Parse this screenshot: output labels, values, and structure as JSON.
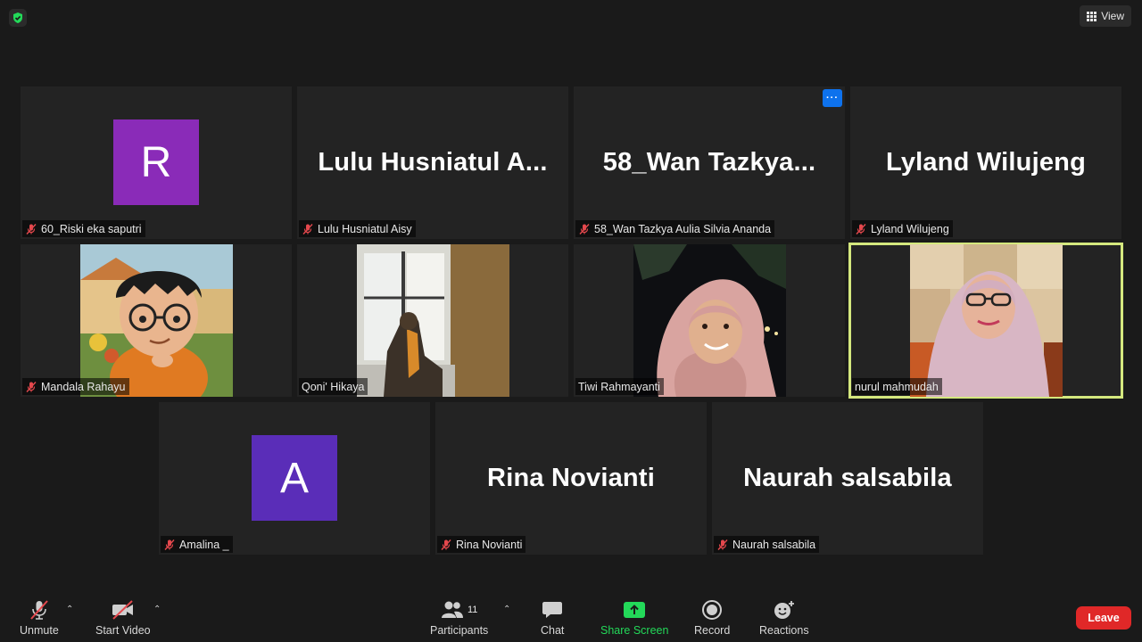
{
  "topbar": {
    "view_label": "View"
  },
  "tiles": [
    {
      "label": "60_Riski eka saputri",
      "avatar_letter": "R",
      "avatar_color": "#8a2bb8"
    },
    {
      "label": "Lulu Husniatul Aisy",
      "big_name": "Lulu  Husniatul  A..."
    },
    {
      "label": "58_Wan Tazkya Aulia Silvia Ananda",
      "big_name": "58_Wan  Tazkya..."
    },
    {
      "label": "Lyland Wilujeng",
      "big_name": "Lyland Wilujeng"
    },
    {
      "label": "Mandala Rahayu"
    },
    {
      "label": "Qoni' Hikaya"
    },
    {
      "label": "Tiwi Rahmayanti"
    },
    {
      "label": "nurul mahmudah"
    },
    {
      "label": "Amalina _",
      "avatar_letter": "A",
      "avatar_color": "#5a2db8"
    },
    {
      "label": "Rina Novianti",
      "big_name": "Rina Novianti"
    },
    {
      "label": "Naurah salsabila",
      "big_name": "Naurah salsabila"
    }
  ],
  "more_button": "···",
  "toolbar": {
    "unmute": "Unmute",
    "start_video": "Start Video",
    "participants": "Participants",
    "participants_count": "11",
    "chat": "Chat",
    "share_screen": "Share Screen",
    "record": "Record",
    "reactions": "Reactions",
    "leave": "Leave"
  },
  "colors": {
    "active_border": "#d4e87e",
    "share_green": "#23d959",
    "leave_red": "#e02828",
    "mute_red": "#e5484d"
  }
}
